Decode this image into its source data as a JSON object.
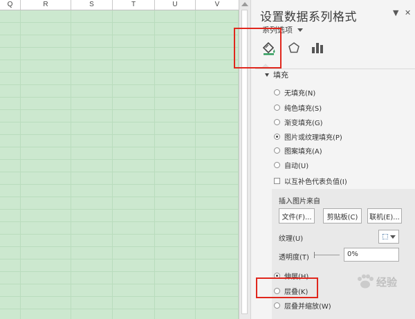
{
  "columns": [
    "Q",
    "R",
    "S",
    "T",
    "U",
    "V"
  ],
  "pane": {
    "title": "设置数据系列格式",
    "ctrl_dropdown": "▼",
    "ctrl_close": "✕",
    "series_options": "系列选项",
    "tabs": [
      "fill-line",
      "effects",
      "series-options"
    ],
    "section_fill": "填充",
    "fill_options": [
      {
        "label": "无填充(N)",
        "checked": false
      },
      {
        "label": "纯色填充(S)",
        "checked": false
      },
      {
        "label": "渐变填充(G)",
        "checked": false
      },
      {
        "label": "图片或纹理填充(P)",
        "checked": true
      },
      {
        "label": "图案填充(A)",
        "checked": false
      },
      {
        "label": "自动(U)",
        "checked": false
      }
    ],
    "invert_checkbox": "以互补色代表负值(I)",
    "insert_picture_from": "插入图片来自",
    "btn_file": "文件(F)...",
    "btn_clipboard": "剪贴板(C)",
    "btn_online": "联机(E)...",
    "texture_label": "纹理(U)",
    "transparency_label": "透明度(T)",
    "transparency_value": "0%",
    "stack_options": [
      {
        "label": "伸展(H)",
        "checked": true
      },
      {
        "label": "层叠(K)",
        "checked": false
      },
      {
        "label": "层叠并缩放(W)",
        "checked": false
      }
    ]
  },
  "watermark_text": "经验",
  "colors": {
    "sheet_bg": "#cce8cf",
    "pane_bg": "#f4f4f4",
    "highlight_box": "#e0261c",
    "bar_icon": "#555555",
    "fill_icon_accent": "#2e9b5b"
  }
}
